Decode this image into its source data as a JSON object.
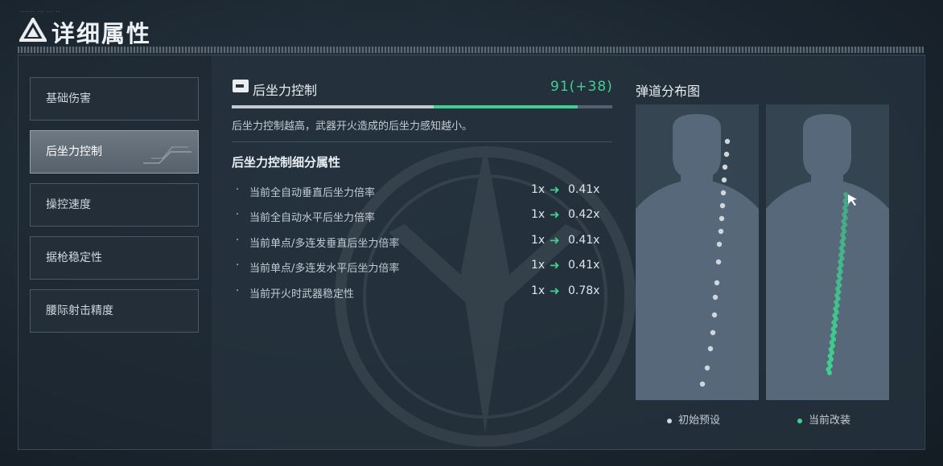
{
  "header": {
    "tiny_text": "...... ... ... ..",
    "title": "详细属性"
  },
  "sidebar": {
    "items": [
      {
        "label": "基础伤害",
        "active": false
      },
      {
        "label": "后坐力控制",
        "active": true
      },
      {
        "label": "操控速度",
        "active": false
      },
      {
        "label": "据枪稳定性",
        "active": false
      },
      {
        "label": "腰际射击精度",
        "active": false
      }
    ]
  },
  "detail": {
    "icon": "rifle-icon",
    "title": "后坐力控制",
    "score": "91(+38)",
    "base_value": 53,
    "bonus_value": 38,
    "description": "后坐力控制越高，武器开火造成的后坐力感知越小。",
    "subtitle": "后坐力控制细分属性",
    "arrow": "➜",
    "stats": [
      {
        "label": "当前全自动垂直后坐力倍率",
        "from": "1x",
        "to": "0.41x"
      },
      {
        "label": "当前全自动水平后坐力倍率",
        "from": "1x",
        "to": "0.42x"
      },
      {
        "label": "当前单点/多连发垂直后坐力倍率",
        "from": "1x",
        "to": "0.41x"
      },
      {
        "label": "当前单点/多连发水平后坐力倍率",
        "from": "1x",
        "to": "0.41x"
      },
      {
        "label": "当前开火时武器稳定性",
        "from": "1x",
        "to": "0.78x"
      }
    ]
  },
  "ballistics": {
    "title": "弹道分布图",
    "legend_initial": "初始预设",
    "legend_current": "当前改装"
  },
  "colors": {
    "accent": "#3fd08f",
    "initial_dot": "#cfd6dc",
    "current_dot": "#3fd08f"
  }
}
